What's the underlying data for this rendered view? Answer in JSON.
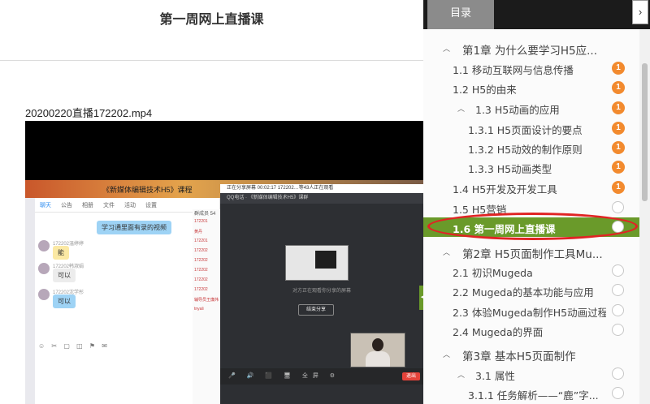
{
  "page": {
    "title": "第一周网上直播课",
    "video_filename": "20200220直播172202.mp4"
  },
  "video": {
    "banner_text": "《新媒体编辑技术H5》课程",
    "chat_tabs": [
      "聊天",
      "公告",
      "相册",
      "文件",
      "活动",
      "设置"
    ],
    "messages": [
      {
        "text": "学习通里面有录的视频"
      },
      {
        "user": "172202温婷婷",
        "text": "能"
      },
      {
        "user": "172202韩淑娟",
        "text": "可以"
      },
      {
        "user": "172202沈学彤",
        "text": "可以"
      }
    ],
    "member_header": "群成员 54",
    "members": [
      "172201",
      "黄丹",
      "172201",
      "172202",
      "172202",
      "172202",
      "172202",
      "172202",
      "辅导员王廉炜",
      "tnyali"
    ],
    "share_bar": "正在分享屏幕    00:02:17    172202…等43人正在观看",
    "live_bar": "QQ电话 · 《新媒体编辑技术H5》课群",
    "share_note": "对方正在观看你分享的屏幕",
    "end_share_label": "结束分享",
    "bottom_bar": "🎤 🔊 ⬛ 🖥 全屏 ⚙",
    "exit_label": "退出"
  },
  "sidebar": {
    "tab_label": "目录",
    "collapse_symbol": "›",
    "items": [
      {
        "label": "第1章 为什么要学习H5应...",
        "level": "chapter",
        "status": "none"
      },
      {
        "label": "1.1 移动互联网与信息传播",
        "level": "section",
        "status": "badge",
        "badge": "1"
      },
      {
        "label": "1.2 H5的由来",
        "level": "section",
        "status": "badge",
        "badge": "1"
      },
      {
        "label": "1.3 H5动画的应用",
        "level": "subchapter",
        "status": "badge",
        "badge": "1"
      },
      {
        "label": "1.3.1 H5页面设计的要点",
        "level": "subsection",
        "status": "badge",
        "badge": "1"
      },
      {
        "label": "1.3.2 H5动效的制作原则",
        "level": "subsection",
        "status": "badge",
        "badge": "1"
      },
      {
        "label": "1.3.3 H5动画类型",
        "level": "subsection",
        "status": "badge",
        "badge": "1"
      },
      {
        "label": "1.4 H5开发及开发工具",
        "level": "section",
        "status": "badge",
        "badge": "1"
      },
      {
        "label": "1.5 H5营销",
        "level": "section",
        "status": "ring"
      },
      {
        "label": "1.6 第一周网上直播课",
        "level": "section",
        "status": "ring",
        "active": true
      },
      {
        "label": "第2章 H5页面制作工具Mu...",
        "level": "chapter",
        "status": "none"
      },
      {
        "label": "2.1 初识Mugeda",
        "level": "section",
        "status": "ring"
      },
      {
        "label": "2.2 Mugeda的基本功能与应用",
        "level": "section",
        "status": "ring"
      },
      {
        "label": "2.3 体验Mugeda制作H5动画过程",
        "level": "section",
        "status": "ring"
      },
      {
        "label": "2.4 Mugeda的界面",
        "level": "section",
        "status": "ring"
      },
      {
        "label": "第3章 基本H5页面制作",
        "level": "chapter",
        "status": "none"
      },
      {
        "label": "3.1 属性",
        "level": "subchapter",
        "status": "ring"
      },
      {
        "label": "3.1.1 任务解析——“鹿”字...",
        "level": "subsection",
        "status": "ring"
      }
    ]
  },
  "colors": {
    "active_row": "#6a9a2a",
    "badge": "#f28a2e",
    "highlight_oval": "#e02424",
    "header": "#1b1b1b"
  }
}
